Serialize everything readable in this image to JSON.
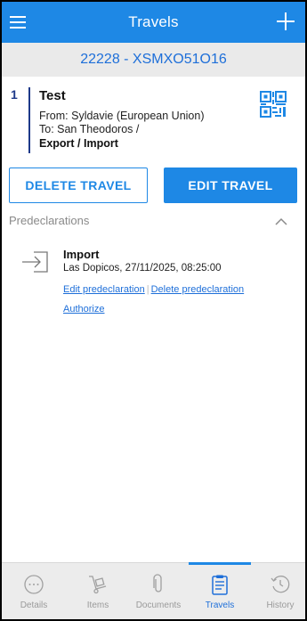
{
  "header": {
    "title": "Travels",
    "subtitle": "22228 - XSMXO51O16"
  },
  "travel": {
    "index": "1",
    "name": "Test",
    "from": "From: Syldavie (European Union)",
    "to": "To: San Theodoros /",
    "kind": "Export / Import"
  },
  "actions": {
    "delete_label": "DELETE TRAVEL",
    "edit_label": "EDIT TRAVEL"
  },
  "predeclarations": {
    "section_title": "Predeclarations",
    "items": [
      {
        "type": "Import",
        "meta": "Las Dopicos, 27/11/2025, 08:25:00",
        "edit_label": "Edit predeclaration",
        "delete_label": "Delete predeclaration",
        "authorize_label": "Authorize"
      }
    ]
  },
  "bottom_nav": {
    "items": [
      {
        "label": "Details",
        "icon": "more-circle-icon"
      },
      {
        "label": "Items",
        "icon": "hand-truck-icon"
      },
      {
        "label": "Documents",
        "icon": "paperclip-icon"
      },
      {
        "label": "Travels",
        "icon": "clipboard-icon"
      },
      {
        "label": "History",
        "icon": "history-icon"
      }
    ],
    "active": "Travels"
  },
  "colors": {
    "primary": "#1e88e5",
    "link": "#1e6fd9",
    "subheader_bg": "#eaeaea",
    "nav_bg": "#ececec"
  }
}
